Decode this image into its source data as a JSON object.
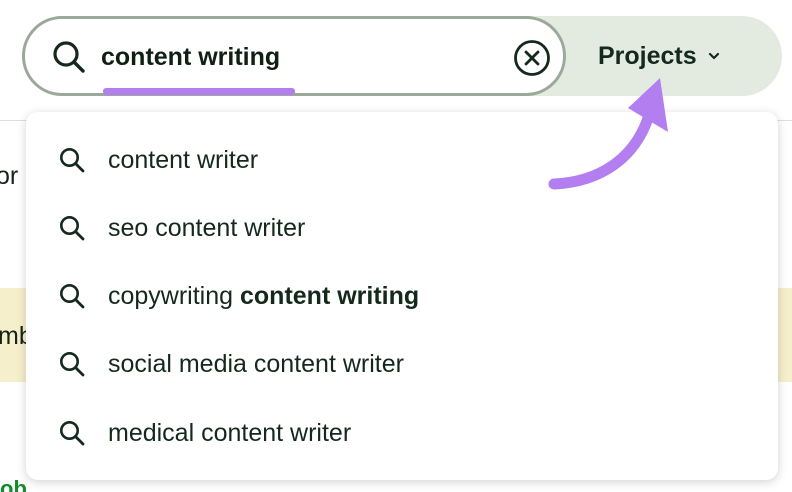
{
  "search": {
    "value": "content writing",
    "clear_label": "Clear search"
  },
  "projects_button": {
    "label": "Projects"
  },
  "suggestions": [
    {
      "prefix": "content writer",
      "bold": ""
    },
    {
      "prefix": "seo content writer",
      "bold": ""
    },
    {
      "prefix": "copywriting ",
      "bold": "content writing"
    },
    {
      "prefix": "social media content writer",
      "bold": ""
    },
    {
      "prefix": "medical content writer",
      "bold": ""
    }
  ],
  "background_fragments": [
    "or",
    "mb",
    "ob"
  ],
  "colors": {
    "accent_purple": "#b37ff0",
    "text_dark_green": "#14291c",
    "pill_bg": "#e3ebe1",
    "banner_yellow": "#f6efcb"
  },
  "icons": {
    "search": "search-icon",
    "clear": "close-circle-icon",
    "chevron": "chevron-down-icon",
    "annotation": "curved-arrow-icon"
  }
}
